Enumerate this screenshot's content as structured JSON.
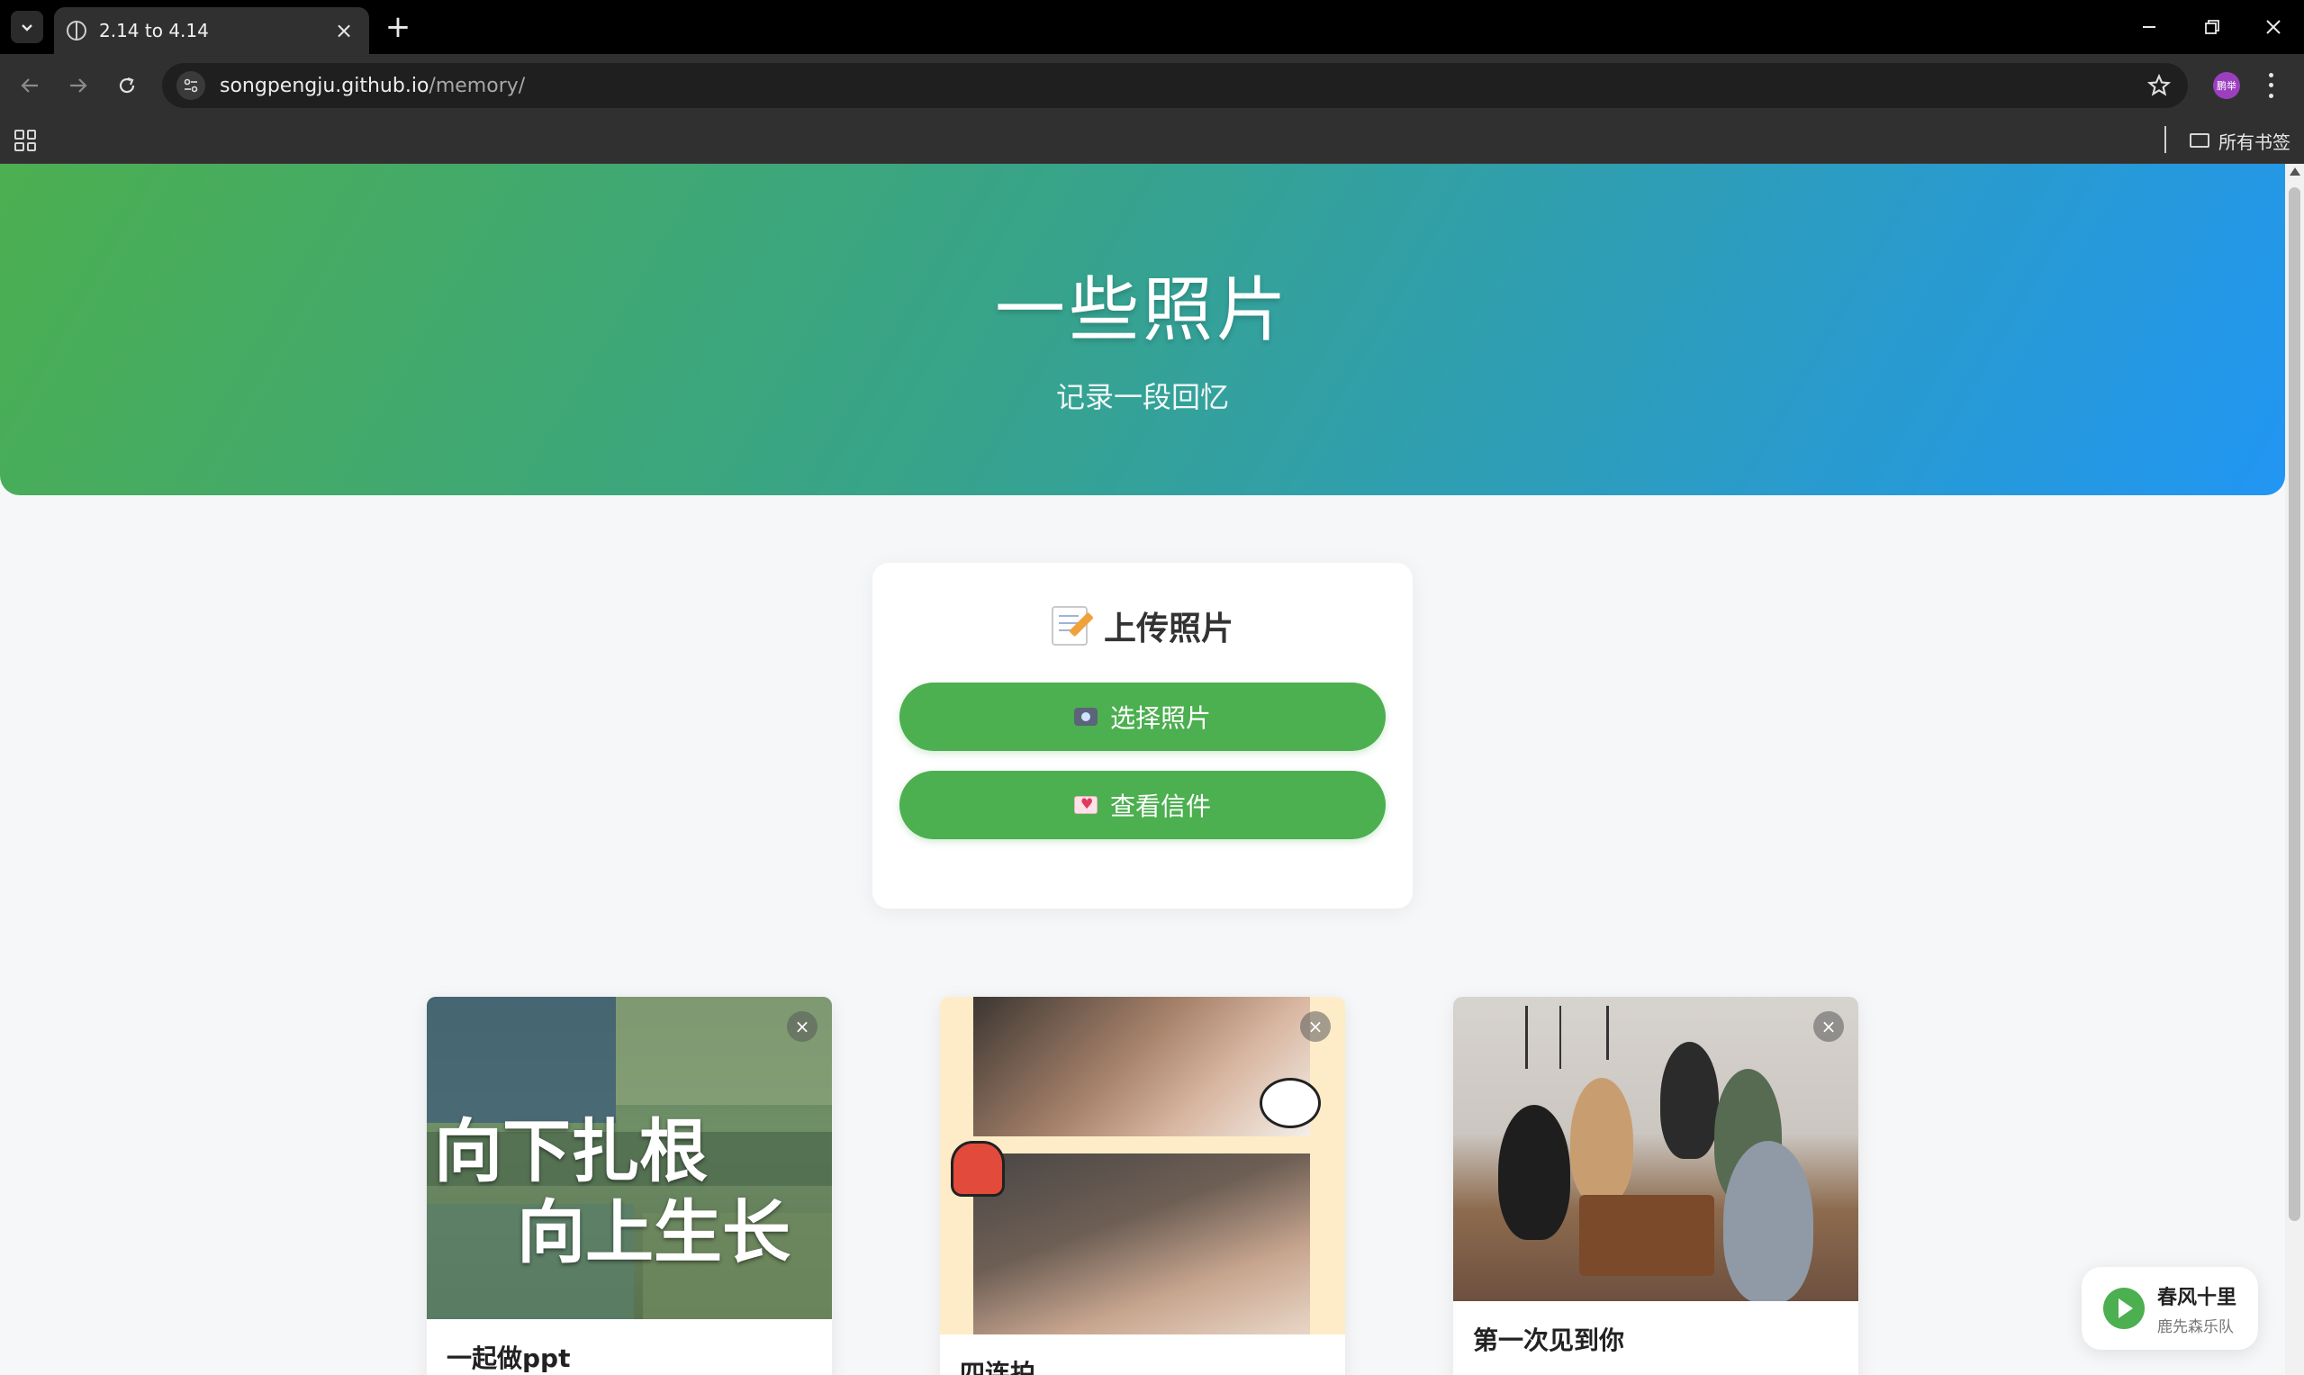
{
  "browser": {
    "tab_title": "2.14 to 4.14",
    "url_host": "songpengju.github.io",
    "url_path": "/memory/",
    "profile_label": "鹏举",
    "all_bookmarks": "所有书签"
  },
  "hero": {
    "title": "一些照片",
    "subtitle": "记录一段回忆"
  },
  "upload": {
    "title": "上传照片",
    "select_button": "选择照片",
    "letters_button": "查看信件"
  },
  "photo_cards": [
    {
      "caption": "一起做ppt",
      "overlay_lines": [
        "向下扎根",
        "向上生长"
      ]
    },
    {
      "caption": "四连拍"
    },
    {
      "caption": "第一次见到你"
    }
  ],
  "music": {
    "song": "春风十里",
    "artist": "鹿先森乐队"
  },
  "colors": {
    "accent_green": "#4caf50",
    "hero_gradient_start": "#4caf50",
    "hero_gradient_end": "#2196f3"
  }
}
